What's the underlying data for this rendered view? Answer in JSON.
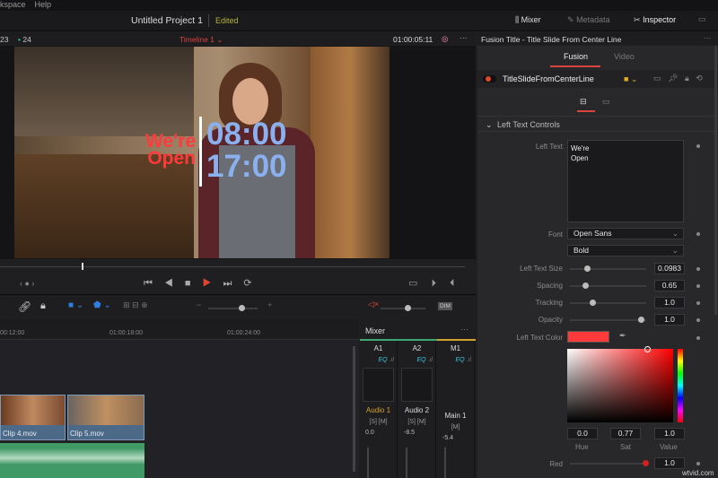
{
  "menu": {
    "items": [
      "kspace",
      "Help"
    ]
  },
  "header": {
    "project_title": "Untitled Project 1",
    "status": "Edited",
    "mixer": "Mixer",
    "metadata": "Metadata",
    "inspector": "Inspector"
  },
  "viewer": {
    "frame_left": "23",
    "frame_right": "24",
    "timeline_name": "Timeline 1",
    "timecode": "01:00:05:11",
    "overlay": {
      "left_line1": "We're",
      "left_line2": "Open",
      "right_line1": "08:00",
      "right_line2": "17:00"
    }
  },
  "timeline": {
    "ruler": [
      "00:12:00",
      "01:00:18:00",
      "01:00:24:00"
    ],
    "clips": [
      {
        "name": "Clip 4.mov"
      },
      {
        "name": "Clip 5.mov"
      }
    ]
  },
  "mixer": {
    "title": "Mixer",
    "channels": [
      {
        "id": "A1",
        "name": "Audio 1",
        "level": "0.0"
      },
      {
        "id": "A2",
        "name": "Audio 2",
        "level": "-8.5"
      },
      {
        "id": "M1",
        "name": "Main 1",
        "level": "-5.4"
      }
    ],
    "eq": "EQ",
    "dim": "DIM"
  },
  "inspector": {
    "title": "Fusion Title - Title Slide From Center Line",
    "tabs": [
      "Fusion",
      "Video"
    ],
    "node": "TitleSlideFromCenterLine",
    "section": "Left Text Controls",
    "left_text_label": "Left Text",
    "left_text": [
      "We're",
      "Open"
    ],
    "font_label": "Font",
    "font": "Open Sans",
    "style": "Bold",
    "params": [
      {
        "label": "Left Text Size",
        "value": "0.0983",
        "pos": 0.2
      },
      {
        "label": "Spacing",
        "value": "0.65",
        "pos": 0.18
      },
      {
        "label": "Tracking",
        "value": "1.0",
        "pos": 0.27
      },
      {
        "label": "Opacity",
        "value": "1.0",
        "pos": 0.95
      }
    ],
    "color_label": "Left Text Color",
    "color": "#ff3a3a",
    "hue": "0.0",
    "sat": "0.77",
    "value": "1.0",
    "hue_label": "Hue",
    "sat_label": "Sat",
    "value_label": "Value",
    "red_label": "Red",
    "red": "1.0"
  },
  "watermark": "wtvid.com"
}
